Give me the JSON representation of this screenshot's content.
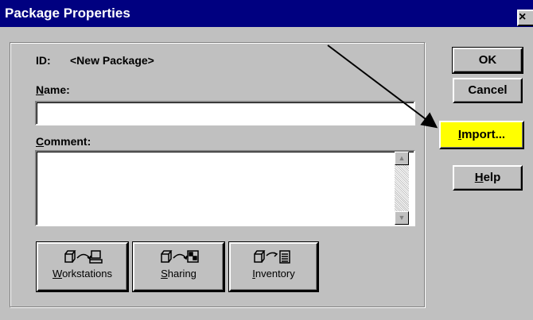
{
  "window": {
    "title": "Package Properties",
    "close_glyph": "×"
  },
  "id_row": {
    "label": "ID:",
    "value": "<New Package>"
  },
  "name": {
    "label_u": "N",
    "label_rest": "ame:",
    "value": ""
  },
  "comment": {
    "label_u": "C",
    "label_rest": "omment:",
    "value": ""
  },
  "buttons": {
    "ok": "OK",
    "cancel": "Cancel",
    "import": {
      "u": "I",
      "rest": "mport..."
    },
    "help": {
      "u": "H",
      "rest": "elp"
    }
  },
  "icon_buttons": [
    {
      "u": "W",
      "rest": "orkstations",
      "icon": "workstation-icon"
    },
    {
      "u": "S",
      "rest": "haring",
      "icon": "sharing-icon"
    },
    {
      "u": "I",
      "rest": "nventory",
      "icon": "inventory-icon"
    }
  ],
  "colors": {
    "titlebar": "#000080",
    "highlight": "#ffff00",
    "face": "#c0c0c0"
  }
}
